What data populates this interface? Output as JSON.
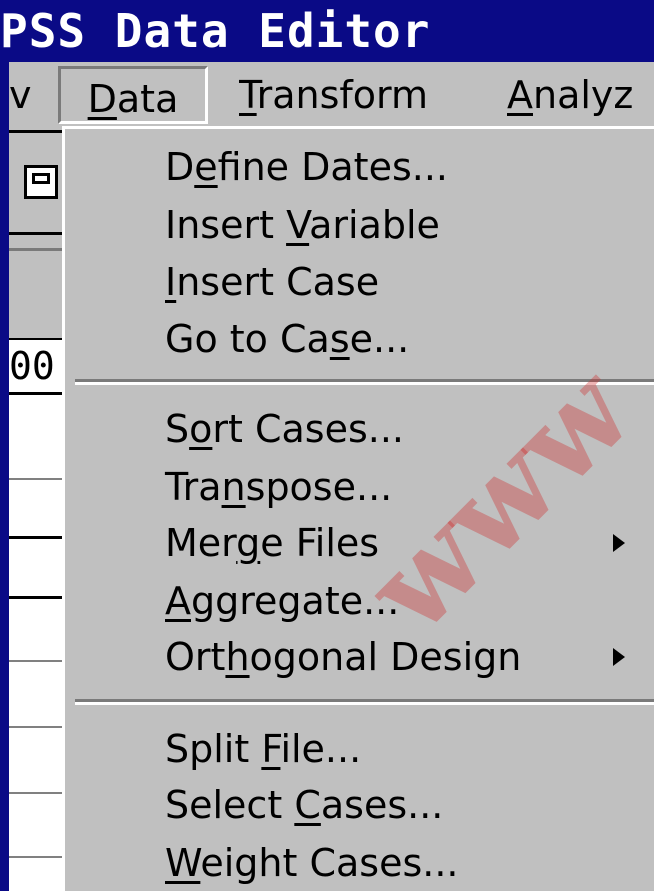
{
  "window": {
    "title": "PSS Data Editor"
  },
  "menubar": {
    "items": [
      {
        "pre": "",
        "key": "",
        "post": "v"
      },
      {
        "pre": "",
        "key": "D",
        "post": "ata"
      },
      {
        "pre": "",
        "key": "T",
        "post": "ransform"
      },
      {
        "pre": "",
        "key": "A",
        "post": "nalyz"
      }
    ]
  },
  "grid": {
    "visible_cell_text": "00"
  },
  "dropdown": {
    "items": [
      {
        "pre": "D",
        "key": "e",
        "post": "fine Dates...",
        "submenu": false
      },
      {
        "pre": "Insert ",
        "key": "V",
        "post": "ariable",
        "submenu": false
      },
      {
        "pre": "",
        "key": "I",
        "post": "nsert Case",
        "submenu": false
      },
      {
        "pre": "Go to Ca",
        "key": "s",
        "post": "e...",
        "submenu": false
      },
      {
        "pre": "S",
        "key": "o",
        "post": "rt Cases...",
        "submenu": false
      },
      {
        "pre": "Tra",
        "key": "n",
        "post": "spose...",
        "submenu": false
      },
      {
        "pre": "Mer",
        "key": "g",
        "post": "e Files",
        "submenu": true
      },
      {
        "pre": "",
        "key": "A",
        "post": "ggregate...",
        "submenu": false
      },
      {
        "pre": "Ort",
        "key": "h",
        "post": "ogonal Design",
        "submenu": true
      },
      {
        "pre": "Split ",
        "key": "F",
        "post": "ile...",
        "submenu": false
      },
      {
        "pre": "Select ",
        "key": "C",
        "post": "ases...",
        "submenu": false
      },
      {
        "pre": "",
        "key": "W",
        "post": "eight Cases...",
        "submenu": false
      }
    ]
  },
  "watermark": {
    "text": "www"
  },
  "colors": {
    "titlebar": "#0a0a86",
    "menu_background": "#c0c0c0",
    "watermark": "#cd2828"
  }
}
